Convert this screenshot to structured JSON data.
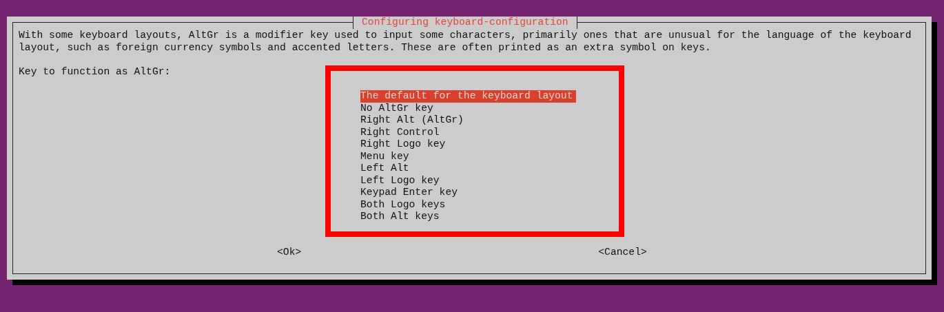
{
  "dialog": {
    "title": "Configuring keyboard-configuration",
    "description": "With some keyboard layouts, AltGr is a modifier key used to input some characters, primarily ones that are unusual for the language of the keyboard layout, such as foreign currency symbols and accented letters. These are often printed as an extra symbol on keys.",
    "prompt": "Key to function as AltGr:",
    "options": [
      {
        "label": "The default for the keyboard layout",
        "selected": true
      },
      {
        "label": "No AltGr key",
        "selected": false
      },
      {
        "label": "Right Alt (AltGr)",
        "selected": false
      },
      {
        "label": "Right Control",
        "selected": false
      },
      {
        "label": "Right Logo key",
        "selected": false
      },
      {
        "label": "Menu key",
        "selected": false
      },
      {
        "label": "Left Alt",
        "selected": false
      },
      {
        "label": "Left Logo key",
        "selected": false
      },
      {
        "label": "Keypad Enter key",
        "selected": false
      },
      {
        "label": "Both Logo keys",
        "selected": false
      },
      {
        "label": "Both Alt keys",
        "selected": false
      }
    ],
    "buttons": [
      "<Ok>",
      "<Cancel>"
    ]
  }
}
